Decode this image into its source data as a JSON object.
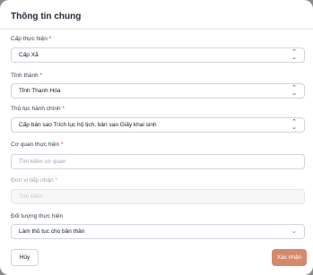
{
  "modal": {
    "title": "Thông tin chung"
  },
  "fields": [
    {
      "label": "Cấp thực hiện",
      "required": "*",
      "value": "Cấp Xã",
      "placeholder": "",
      "type": "select"
    },
    {
      "label": "Tỉnh thành",
      "required": "*",
      "value": "Tỉnh Thanh Hóa",
      "placeholder": "",
      "type": "select"
    },
    {
      "label": "Thủ tục hành chính",
      "required": "*",
      "value": "Cấp bản sao Trích lục hộ tịch, bản sao Giấy khai sinh",
      "placeholder": "",
      "type": "select"
    },
    {
      "label": "Cơ quan thực hiện",
      "required": "*",
      "value": "",
      "placeholder": "Tìm kiếm cơ quan",
      "type": "search"
    },
    {
      "label": "Đơn vị tiếp nhận",
      "required": "*",
      "value": "",
      "placeholder": "Tìm kiếm",
      "type": "search-disabled"
    },
    {
      "label": "Đối tượng thực hiện",
      "required": "",
      "value": "Làm thủ tục cho bản thân",
      "placeholder": "",
      "type": "dropdown"
    }
  ],
  "icons": {
    "select": "updown-chevron-icon",
    "dropdown": "chevron-down-icon"
  },
  "buttons": {
    "cancel": "Hủy",
    "confirm": "Xác nhận"
  },
  "colors": {
    "accent": "#d4896a",
    "required": "#dc2626"
  }
}
